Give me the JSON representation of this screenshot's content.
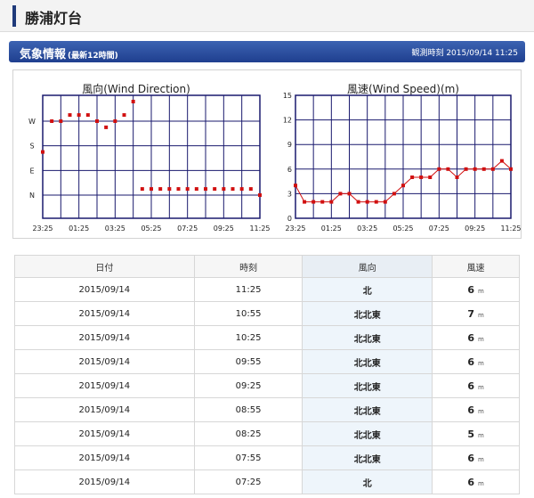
{
  "header": {
    "title": "勝浦灯台"
  },
  "info_bar": {
    "title": "気象情報",
    "subtitle": "(最新12時間)",
    "observed_label": "観測時刻",
    "observed_time": "2015/09/14 11:25"
  },
  "colors": {
    "grid": "#1a1a6e",
    "marker": "#d11010",
    "accent": "#1f3f8f"
  },
  "chart_data": [
    {
      "type": "scatter",
      "title": "風向(Wind Direction)",
      "x": [
        "23:25",
        "23:55",
        "00:25",
        "00:55",
        "01:25",
        "01:55",
        "02:25",
        "02:55",
        "03:25",
        "03:55",
        "04:25",
        "04:55",
        "05:25",
        "05:55",
        "06:25",
        "06:55",
        "07:25",
        "07:55",
        "08:25",
        "08:55",
        "09:25",
        "09:55",
        "10:25",
        "10:55",
        "11:25"
      ],
      "x_tick_labels": [
        "23:25",
        "01:25",
        "03:25",
        "05:25",
        "07:25",
        "09:25",
        "11:25"
      ],
      "y_categories": [
        "N",
        "NNE",
        "NE",
        "ENE",
        "E",
        "ESE",
        "SE",
        "SSE",
        "S",
        "SSW",
        "SW",
        "WSW",
        "W",
        "WNW"
      ],
      "y_tick_labels": [
        "N",
        "E",
        "S",
        "W"
      ],
      "values": [
        "SSE",
        "W",
        "W",
        "WNW",
        "WNW",
        "WNW",
        "W",
        "WSW",
        "W",
        "WNW",
        "NW",
        "NNE",
        "NNE",
        "NNE",
        "NNE",
        "NNE",
        "NNE",
        "NNE",
        "NNE",
        "NNE",
        "NNE",
        "NNE",
        "NNE",
        "NNE",
        "N"
      ],
      "grid": true
    },
    {
      "type": "line",
      "title": "風速(Wind Speed)(m)",
      "x": [
        "23:25",
        "23:55",
        "00:25",
        "00:55",
        "01:25",
        "01:55",
        "02:25",
        "02:55",
        "03:25",
        "03:55",
        "04:25",
        "04:55",
        "05:25",
        "05:55",
        "06:25",
        "06:55",
        "07:25",
        "07:55",
        "08:25",
        "08:55",
        "09:25",
        "09:55",
        "10:25",
        "10:55",
        "11:25"
      ],
      "x_tick_labels": [
        "23:25",
        "01:25",
        "03:25",
        "05:25",
        "07:25",
        "09:25",
        "11:25"
      ],
      "y_ticks": [
        0,
        3,
        6,
        9,
        12,
        15
      ],
      "ylim": [
        0,
        15
      ],
      "values": [
        4,
        2,
        2,
        2,
        2,
        3,
        3,
        2,
        2,
        2,
        2,
        3,
        4,
        5,
        5,
        5,
        6,
        6,
        5,
        6,
        6,
        6,
        6,
        7,
        6
      ],
      "grid": true
    }
  ],
  "table": {
    "headers": [
      "日付",
      "時刻",
      "風向",
      "風速"
    ],
    "speed_unit": "m",
    "rows": [
      {
        "date": "2015/09/14",
        "time": "11:25",
        "dir": "北",
        "speed": "6"
      },
      {
        "date": "2015/09/14",
        "time": "10:55",
        "dir": "北北東",
        "speed": "7"
      },
      {
        "date": "2015/09/14",
        "time": "10:25",
        "dir": "北北東",
        "speed": "6"
      },
      {
        "date": "2015/09/14",
        "time": "09:55",
        "dir": "北北東",
        "speed": "6"
      },
      {
        "date": "2015/09/14",
        "time": "09:25",
        "dir": "北北東",
        "speed": "6"
      },
      {
        "date": "2015/09/14",
        "time": "08:55",
        "dir": "北北東",
        "speed": "6"
      },
      {
        "date": "2015/09/14",
        "time": "08:25",
        "dir": "北北東",
        "speed": "5"
      },
      {
        "date": "2015/09/14",
        "time": "07:55",
        "dir": "北北東",
        "speed": "6"
      },
      {
        "date": "2015/09/14",
        "time": "07:25",
        "dir": "北",
        "speed": "6"
      }
    ]
  }
}
